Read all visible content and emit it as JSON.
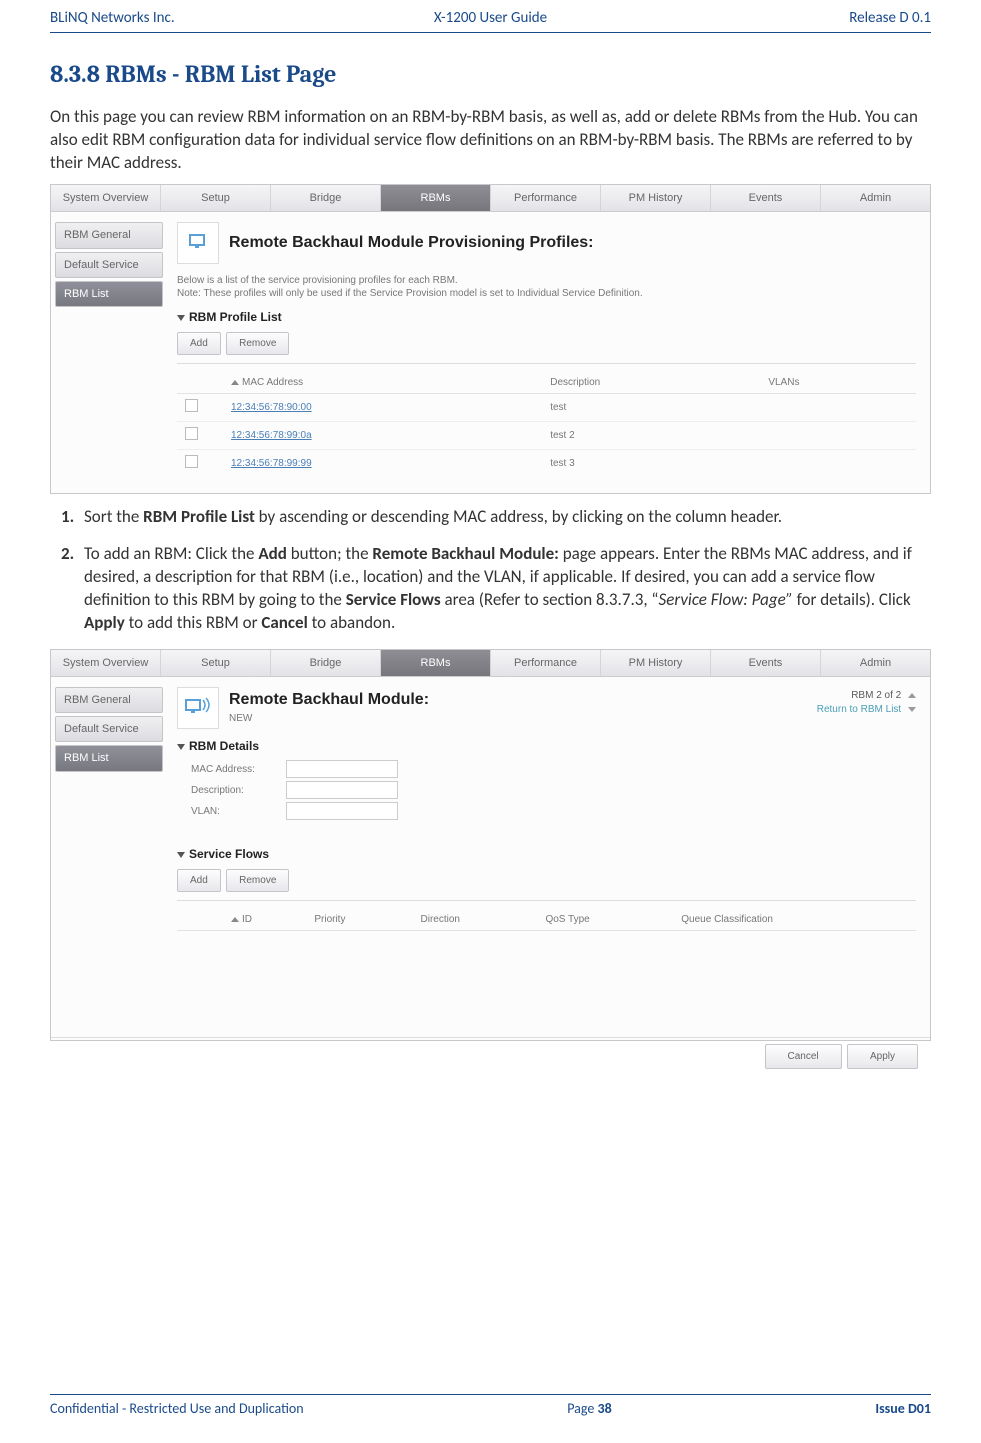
{
  "header": {
    "left": "BLiNQ Networks Inc.",
    "center": "X-1200 User Guide",
    "right": "Release D 0.1"
  },
  "heading": "8.3.8 RBMs - RBM List Page",
  "intro": "On this page you can review RBM information on an RBM-by-RBM basis, as well as, add or delete RBMs from the Hub. You can also edit RBM configuration data for individual service flow definitions on an RBM-by-RBM basis. The RBMs are referred to by their MAC address.",
  "tabs": [
    "System Overview",
    "Setup",
    "Bridge",
    "RBMs",
    "Performance",
    "PM History",
    "Events",
    "Admin"
  ],
  "side": [
    "RBM General",
    "Default Service",
    "RBM List"
  ],
  "ss1": {
    "title": "Remote Backhaul Module Provisioning Profiles:",
    "note1": "Below is a list of the service provisioning profiles for each RBM.",
    "note2": "Note: These profiles will only be used if the Service Provision model is set to Individual Service Definition.",
    "section": "RBM Profile List",
    "add": "Add",
    "remove": "Remove",
    "cols": {
      "mac": "MAC Address",
      "desc": "Description",
      "vlan": "VLANs"
    },
    "rows": [
      {
        "mac": "12:34:56:78:90:00",
        "desc": "test"
      },
      {
        "mac": "12:34:56:78:99:0a",
        "desc": "test 2"
      },
      {
        "mac": "12:34:56:78:99:99",
        "desc": "test 3"
      }
    ]
  },
  "step1": {
    "pre": "Sort the ",
    "b1": "RBM Profile List",
    "post": " by ascending or descending MAC address, by clicking on the column header."
  },
  "step2": {
    "t1": "To add an RBM: Click the ",
    "b1": "Add",
    "t2": " button; the ",
    "b2": "Remote Backhaul Module:",
    "t3": " page appears. Enter the RBMs MAC address, and if desired, a description for that RBM (i.e., location) and the VLAN, if applicable. If desired, you can add a service flow definition to this RBM by going to the ",
    "b3": "Service Flows",
    "t4": " area (Refer to section 8.3.7.3, “",
    "i1": "Service Flow: Page”",
    "t5": " for details). Click ",
    "b4": "Apply",
    "t6": " to add this RBM or ",
    "b5": "Cancel",
    "t7": " to abandon."
  },
  "ss2": {
    "title": "Remote Backhaul Module:",
    "sub": "NEW",
    "counter": "RBM 2 of 2",
    "return": "Return to RBM List",
    "section1": "RBM Details",
    "fields": {
      "mac": "MAC Address:",
      "desc": "Description:",
      "vlan": "VLAN:"
    },
    "section2": "Service Flows",
    "add": "Add",
    "remove": "Remove",
    "cols": {
      "id": "ID",
      "prio": "Priority",
      "dir": "Direction",
      "qos": "QoS Type",
      "qc": "Queue Classification"
    },
    "cancel": "Cancel",
    "apply": "Apply"
  },
  "footer": {
    "left": "Confidential - Restricted Use and Duplication",
    "page_pre": "Page ",
    "page_num": "38",
    "right": "Issue D01"
  }
}
